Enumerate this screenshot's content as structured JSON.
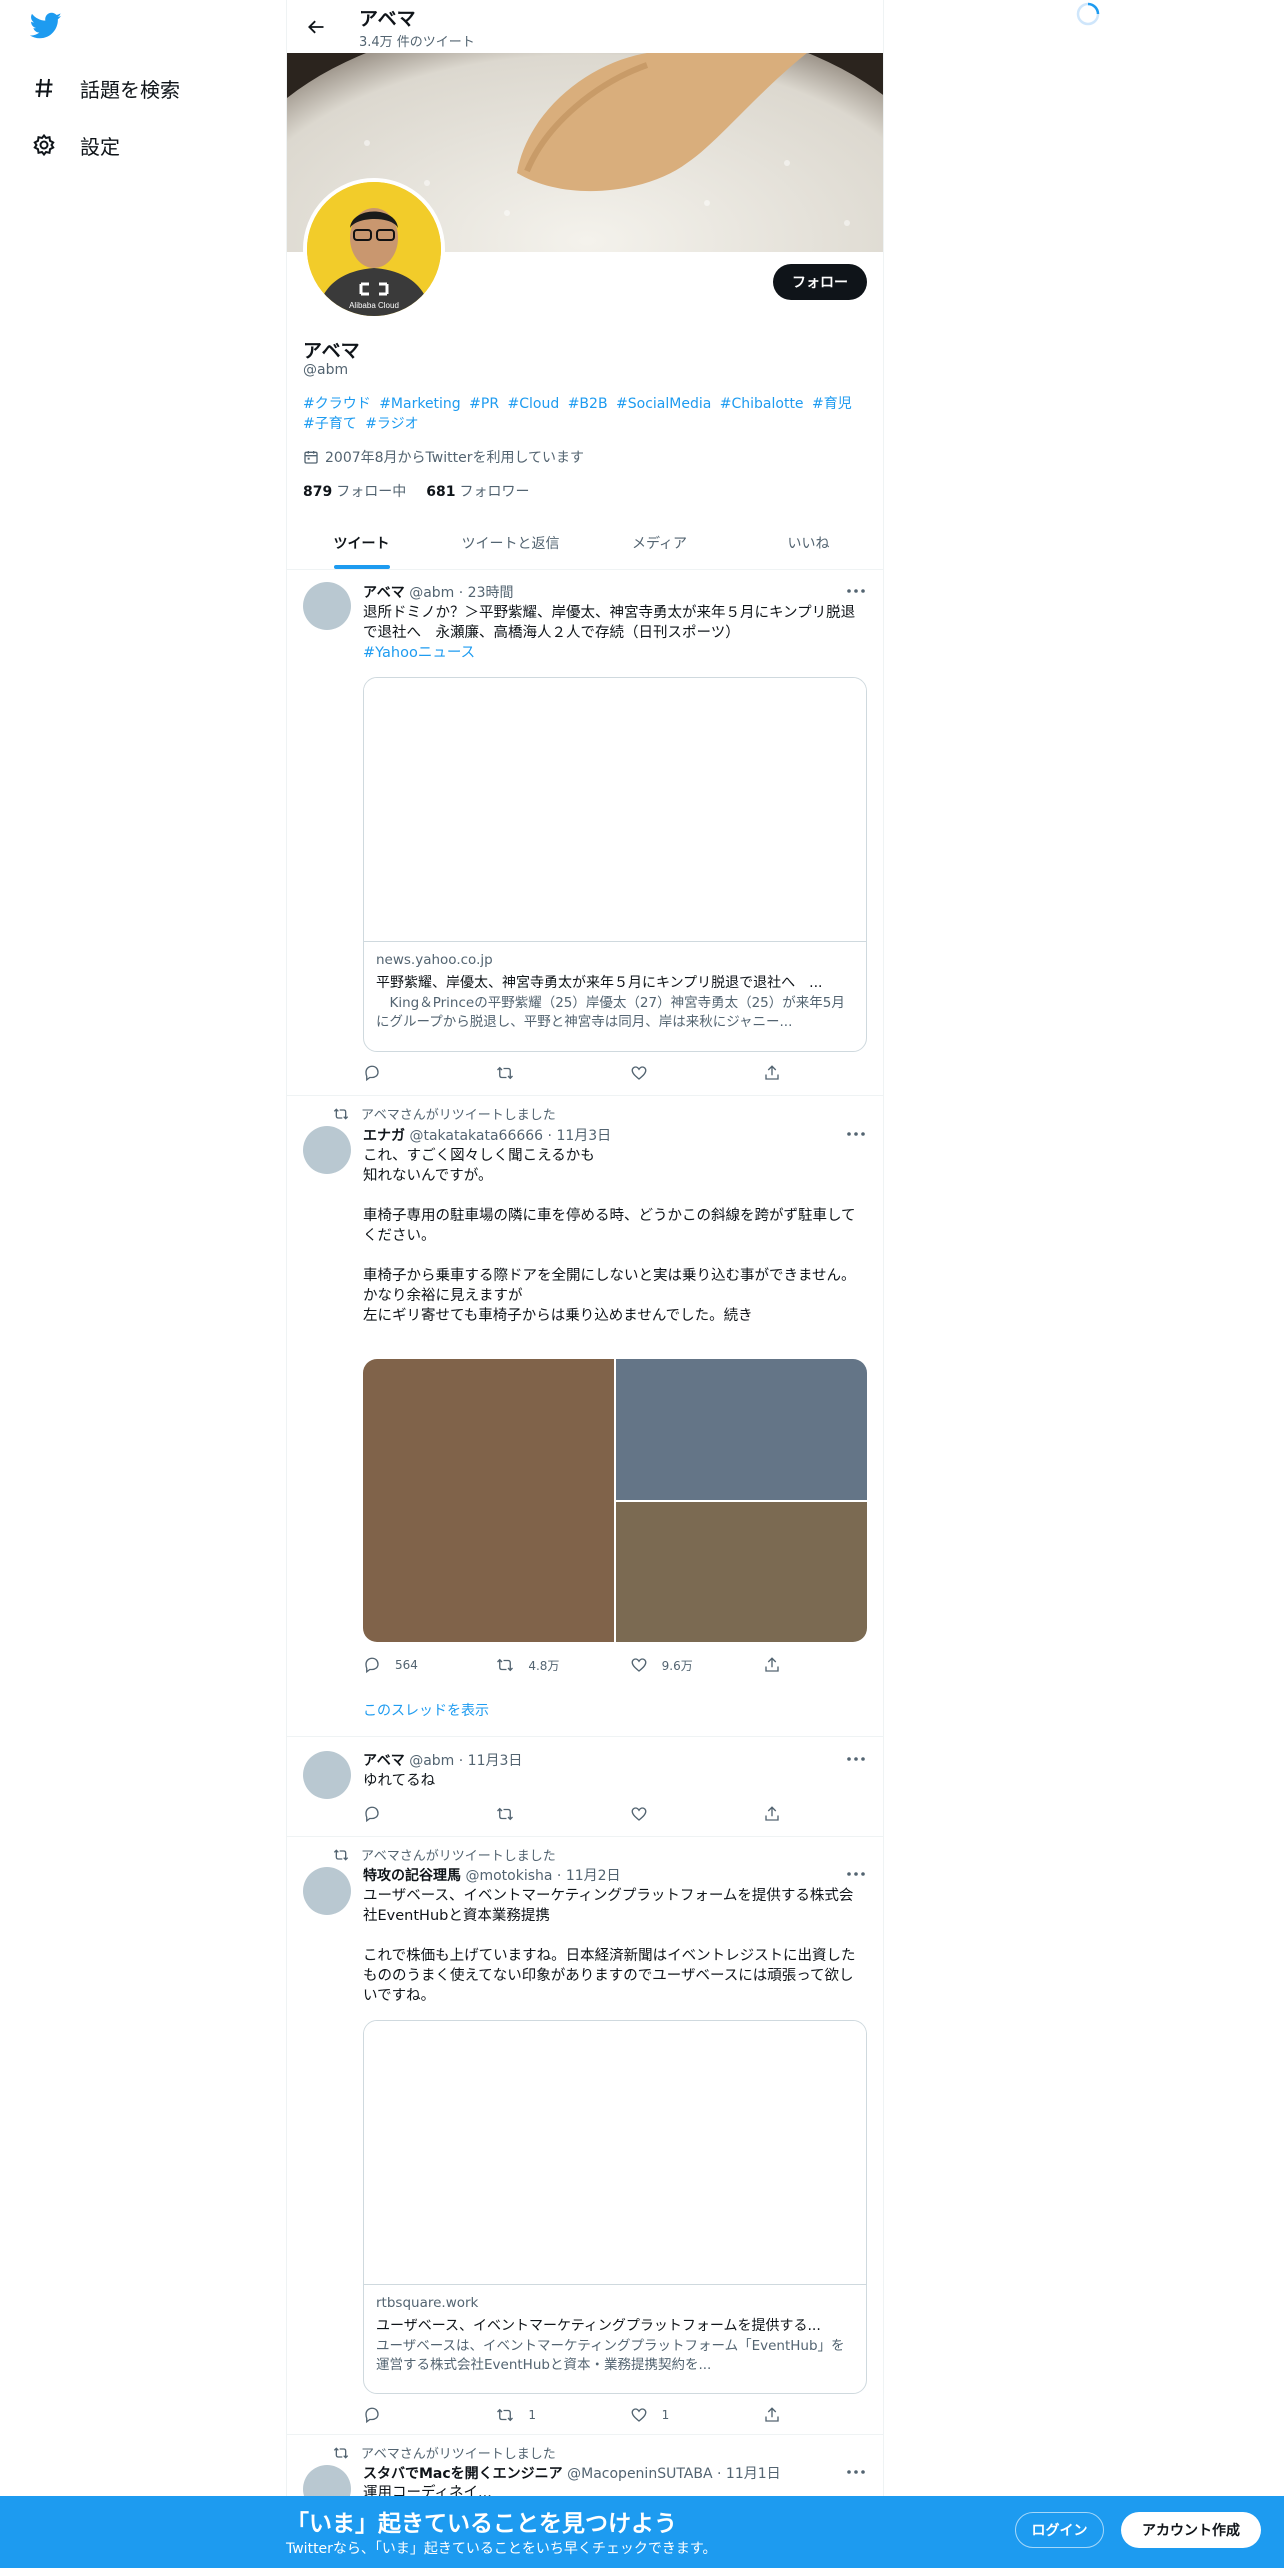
{
  "nav": {
    "logo": "twitter-bird-icon",
    "items": [
      {
        "icon": "hashtag-icon",
        "label": "話題を検索"
      },
      {
        "icon": "gear-icon",
        "label": "設定"
      }
    ]
  },
  "header": {
    "title": "アベマ",
    "subtitle": "3.4万 件のツイート"
  },
  "profile": {
    "name": "アベマ",
    "handle": "@abm",
    "follow_label": "フォロー",
    "bio_tags": [
      "#クラウド",
      "#Marketing",
      "#PR",
      "#Cloud",
      "#B2B",
      "#SocialMedia",
      "#Chibalotte",
      "#育児",
      "#子育て",
      "#ラジオ"
    ],
    "joined": "2007年8月からTwitterを利用しています",
    "following_count": "879",
    "following_label": "フォロー中",
    "followers_count": "681",
    "followers_label": "フォロワー",
    "avatar_shirt_text": "Alibaba Cloud"
  },
  "tabs": [
    "ツイート",
    "ツイートと返信",
    "メディア",
    "いいね"
  ],
  "tweets": [
    {
      "name": "アベマ",
      "handle": "@abm",
      "time": "23時間",
      "text": "退所ドミノか？＞平野紫耀、岸優太、神宮寺勇太が来年５月にキンプリ脱退で退社へ　永瀬廉、高橋海人２人で存続（日刊スポーツ）",
      "link": "#Yahooニュース",
      "card": {
        "domain": "news.yahoo.co.jp",
        "title": "平野紫耀、岸優太、神宮寺勇太が来年５月にキンプリ脱退で退社へ　...",
        "desc": "　King＆Princeの平野紫耀（25）岸優太（27）神宮寺勇太（25）が来年5月にグループから脱退し、平野と神宮寺は同月、岸は来秋にジャニー..."
      },
      "actions": {
        "reply": "",
        "retweet": "",
        "like": ""
      }
    },
    {
      "retweeted_by": "アベマさんがリツイートしました",
      "name": "エナガ",
      "handle": "@takatakata66666",
      "time": "11月3日",
      "text": "これ、すごく図々しく聞こえるかも\n知れないんですが。\n\n車椅子専用の駐車場の隣に車を停める時、どうかこの斜線を跨がず駐車してください。\n\n車椅子から乗車する際ドアを全開にしないと実は乗り込む事ができません。\nかなり余裕に見えますが\n左にギリ寄せても車椅子からは乗り込めませんでした。続き",
      "actions": {
        "reply": "564",
        "retweet": "4.8万",
        "like": "9.6万"
      },
      "thread": "このスレッドを表示"
    },
    {
      "name": "アベマ",
      "handle": "@abm",
      "time": "11月3日",
      "text": "ゆれてるね",
      "actions": {
        "reply": "",
        "retweet": "",
        "like": ""
      }
    },
    {
      "retweeted_by": "アベマさんがリツイートしました",
      "name": "特攻の記谷理馬",
      "handle": "@motokisha",
      "time": "11月2日",
      "text": "ユーザベース、イベントマーケティングプラットフォームを提供する株式会社EventHubと資本業務提携\n\nこれで株価も上げていますね。日本経済新聞はイベントレジストに出資したもののうまく使えてない印象がありますのでユーザベースには頑張って欲しいですね。",
      "card": {
        "domain": "rtbsquare.work",
        "title": "ユーザベース、イベントマーケティングプラットフォームを提供する...",
        "desc": "ユーザベースは、イベントマーケティングプラットフォーム「EventHub」を運営する株式会社EventHubと資本・業務提携契約を..."
      },
      "actions": {
        "reply": "",
        "retweet": "1",
        "like": "1"
      }
    },
    {
      "retweeted_by": "アベマさんがリツイートしました",
      "name": "スタバでMacを開くエンジニア",
      "handle": "@MacopeninSUTABA",
      "time": "11月1日",
      "text": "運用コーディネイ..."
    }
  ],
  "bottom": {
    "title": "「いま」起きていることを見つけよう",
    "subtitle": "Twitterなら、「いま」起きていることをいち早くチェックできます。",
    "login": "ログイン",
    "signup": "アカウント作成"
  },
  "colors": {
    "accent": "#1d9bf0",
    "text": "#0f1419",
    "muted": "#536471"
  }
}
